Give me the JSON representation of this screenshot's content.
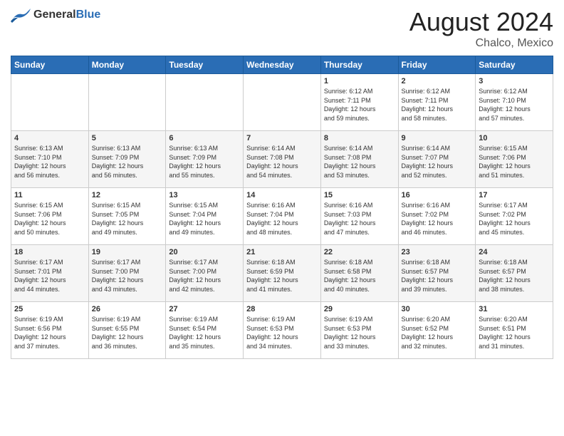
{
  "header": {
    "logo_general": "General",
    "logo_blue": "Blue",
    "month_title": "August 2024",
    "location": "Chalco, Mexico"
  },
  "days_of_week": [
    "Sunday",
    "Monday",
    "Tuesday",
    "Wednesday",
    "Thursday",
    "Friday",
    "Saturday"
  ],
  "weeks": [
    [
      {
        "day": "",
        "content": ""
      },
      {
        "day": "",
        "content": ""
      },
      {
        "day": "",
        "content": ""
      },
      {
        "day": "",
        "content": ""
      },
      {
        "day": "1",
        "content": "Sunrise: 6:12 AM\nSunset: 7:11 PM\nDaylight: 12 hours\nand 59 minutes."
      },
      {
        "day": "2",
        "content": "Sunrise: 6:12 AM\nSunset: 7:11 PM\nDaylight: 12 hours\nand 58 minutes."
      },
      {
        "day": "3",
        "content": "Sunrise: 6:12 AM\nSunset: 7:10 PM\nDaylight: 12 hours\nand 57 minutes."
      }
    ],
    [
      {
        "day": "4",
        "content": "Sunrise: 6:13 AM\nSunset: 7:10 PM\nDaylight: 12 hours\nand 56 minutes."
      },
      {
        "day": "5",
        "content": "Sunrise: 6:13 AM\nSunset: 7:09 PM\nDaylight: 12 hours\nand 56 minutes."
      },
      {
        "day": "6",
        "content": "Sunrise: 6:13 AM\nSunset: 7:09 PM\nDaylight: 12 hours\nand 55 minutes."
      },
      {
        "day": "7",
        "content": "Sunrise: 6:14 AM\nSunset: 7:08 PM\nDaylight: 12 hours\nand 54 minutes."
      },
      {
        "day": "8",
        "content": "Sunrise: 6:14 AM\nSunset: 7:08 PM\nDaylight: 12 hours\nand 53 minutes."
      },
      {
        "day": "9",
        "content": "Sunrise: 6:14 AM\nSunset: 7:07 PM\nDaylight: 12 hours\nand 52 minutes."
      },
      {
        "day": "10",
        "content": "Sunrise: 6:15 AM\nSunset: 7:06 PM\nDaylight: 12 hours\nand 51 minutes."
      }
    ],
    [
      {
        "day": "11",
        "content": "Sunrise: 6:15 AM\nSunset: 7:06 PM\nDaylight: 12 hours\nand 50 minutes."
      },
      {
        "day": "12",
        "content": "Sunrise: 6:15 AM\nSunset: 7:05 PM\nDaylight: 12 hours\nand 49 minutes."
      },
      {
        "day": "13",
        "content": "Sunrise: 6:15 AM\nSunset: 7:04 PM\nDaylight: 12 hours\nand 49 minutes."
      },
      {
        "day": "14",
        "content": "Sunrise: 6:16 AM\nSunset: 7:04 PM\nDaylight: 12 hours\nand 48 minutes."
      },
      {
        "day": "15",
        "content": "Sunrise: 6:16 AM\nSunset: 7:03 PM\nDaylight: 12 hours\nand 47 minutes."
      },
      {
        "day": "16",
        "content": "Sunrise: 6:16 AM\nSunset: 7:02 PM\nDaylight: 12 hours\nand 46 minutes."
      },
      {
        "day": "17",
        "content": "Sunrise: 6:17 AM\nSunset: 7:02 PM\nDaylight: 12 hours\nand 45 minutes."
      }
    ],
    [
      {
        "day": "18",
        "content": "Sunrise: 6:17 AM\nSunset: 7:01 PM\nDaylight: 12 hours\nand 44 minutes."
      },
      {
        "day": "19",
        "content": "Sunrise: 6:17 AM\nSunset: 7:00 PM\nDaylight: 12 hours\nand 43 minutes."
      },
      {
        "day": "20",
        "content": "Sunrise: 6:17 AM\nSunset: 7:00 PM\nDaylight: 12 hours\nand 42 minutes."
      },
      {
        "day": "21",
        "content": "Sunrise: 6:18 AM\nSunset: 6:59 PM\nDaylight: 12 hours\nand 41 minutes."
      },
      {
        "day": "22",
        "content": "Sunrise: 6:18 AM\nSunset: 6:58 PM\nDaylight: 12 hours\nand 40 minutes."
      },
      {
        "day": "23",
        "content": "Sunrise: 6:18 AM\nSunset: 6:57 PM\nDaylight: 12 hours\nand 39 minutes."
      },
      {
        "day": "24",
        "content": "Sunrise: 6:18 AM\nSunset: 6:57 PM\nDaylight: 12 hours\nand 38 minutes."
      }
    ],
    [
      {
        "day": "25",
        "content": "Sunrise: 6:19 AM\nSunset: 6:56 PM\nDaylight: 12 hours\nand 37 minutes."
      },
      {
        "day": "26",
        "content": "Sunrise: 6:19 AM\nSunset: 6:55 PM\nDaylight: 12 hours\nand 36 minutes."
      },
      {
        "day": "27",
        "content": "Sunrise: 6:19 AM\nSunset: 6:54 PM\nDaylight: 12 hours\nand 35 minutes."
      },
      {
        "day": "28",
        "content": "Sunrise: 6:19 AM\nSunset: 6:53 PM\nDaylight: 12 hours\nand 34 minutes."
      },
      {
        "day": "29",
        "content": "Sunrise: 6:19 AM\nSunset: 6:53 PM\nDaylight: 12 hours\nand 33 minutes."
      },
      {
        "day": "30",
        "content": "Sunrise: 6:20 AM\nSunset: 6:52 PM\nDaylight: 12 hours\nand 32 minutes."
      },
      {
        "day": "31",
        "content": "Sunrise: 6:20 AM\nSunset: 6:51 PM\nDaylight: 12 hours\nand 31 minutes."
      }
    ]
  ]
}
